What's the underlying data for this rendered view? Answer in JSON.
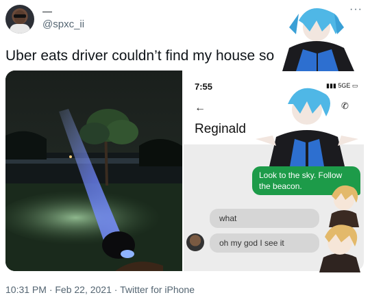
{
  "tweet": {
    "display_name": "—",
    "handle": "@spxc_ii",
    "more_icon": "more-icon",
    "text": "Uber eats driver couldn’t find my house so",
    "timestamp": "10:31 PM · Feb 22, 2021 · Twitter for iPhone"
  },
  "phone_screenshot": {
    "status_time": "7:55",
    "status_icons": "5GE",
    "contact_name": "Reginald",
    "messages": [
      {
        "from": "me",
        "text": "Look to the sky. Follow the beacon."
      },
      {
        "from": "them",
        "text": "what"
      },
      {
        "from": "them",
        "text": "oh my god I see it"
      }
    ]
  },
  "colors": {
    "sent_bubble": "#1d9b49",
    "received_bubble": "#d6d6d6",
    "chat_background": "#ececec",
    "secondary_text": "#536471"
  }
}
